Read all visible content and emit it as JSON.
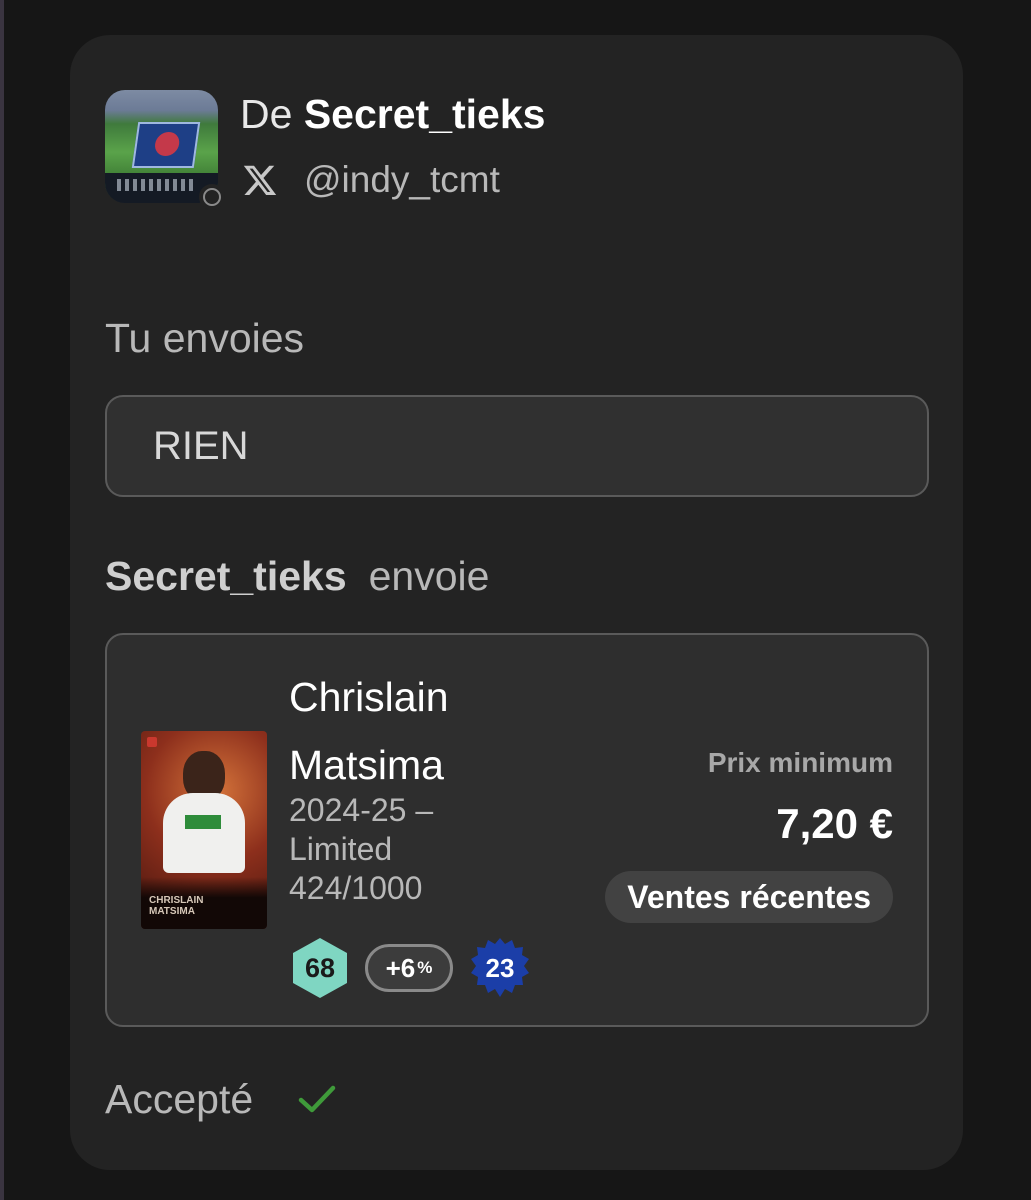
{
  "header": {
    "from_prefix": "De",
    "username": "Secret_tieks",
    "handle": "@indy_tcmt",
    "social_icon": "x-logo-icon"
  },
  "you_send": {
    "label": "Tu envoies",
    "value": "RIEN"
  },
  "other_sends": {
    "username": "Secret_tieks",
    "verb": "envoie"
  },
  "card": {
    "name_line1": "Chrislain",
    "name_line2": "Matsima",
    "season": "2024-25 –",
    "rarity": "Limited",
    "serial": "424/1000",
    "card_name_plate_line1": "CHRISLAIN",
    "card_name_plate_line2": "MATSIMA",
    "score": "68",
    "bonus": "+6",
    "bonus_unit": "%",
    "level": "23",
    "price_label": "Prix minimum",
    "price_value": "7,20 €",
    "recent_sales_label": "Ventes récentes"
  },
  "status": {
    "label": "Accepté",
    "icon": "check-icon",
    "color": "#3f9a3a"
  },
  "colors": {
    "panel": "#232323",
    "score_badge": "#7fd6c2",
    "level_badge": "#1b3ea8"
  }
}
